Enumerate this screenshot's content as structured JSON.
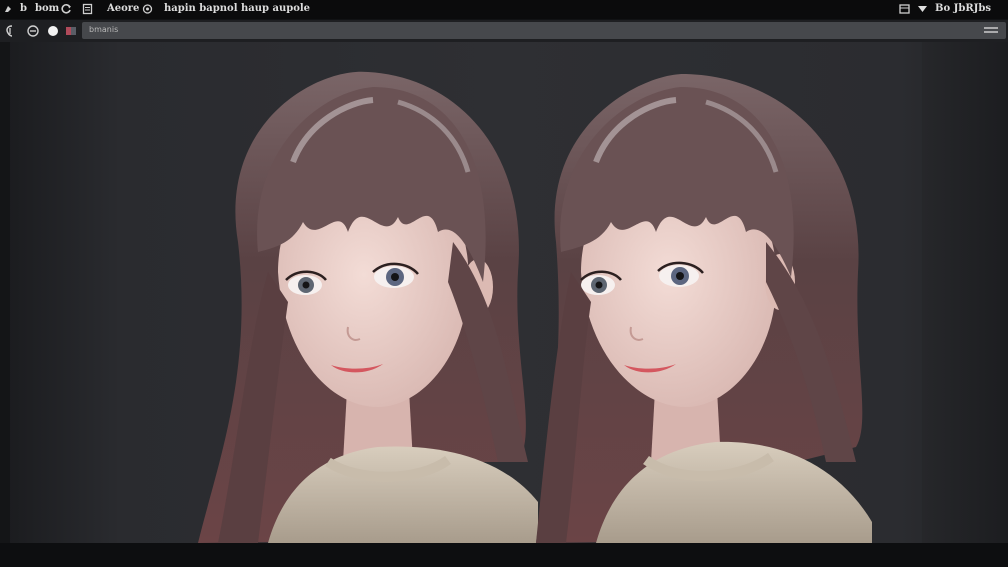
{
  "menubar": {
    "items": [
      {
        "label": "b"
      },
      {
        "label": "bom"
      },
      {
        "label": "Aeore"
      },
      {
        "label": "hapin bapnol haup aupole"
      }
    ],
    "right_text": "Bo JbRJbs"
  },
  "toolbar": {
    "address_text": "bmanis"
  },
  "colors": {
    "menubar_bg": "#0b0b0c",
    "toolbar_bg": "#1e1f22",
    "address_bg": "#46484c",
    "canvas_bg": "#2e2f33"
  },
  "canvas": {
    "images": [
      {
        "name": "portrait-left"
      },
      {
        "name": "portrait-right"
      }
    ]
  }
}
